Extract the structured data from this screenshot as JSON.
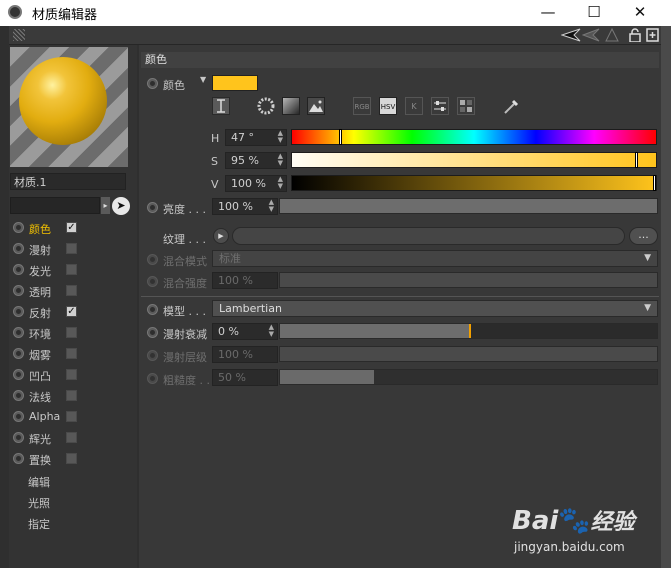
{
  "window": {
    "title": "材质编辑器",
    "minimize": "—",
    "maximize": "☐",
    "close": "✕"
  },
  "material": {
    "name": "材质.1",
    "name_field": ""
  },
  "channels": [
    {
      "label": "颜色",
      "checked": true,
      "active": true
    },
    {
      "label": "漫射",
      "checked": false,
      "active": false
    },
    {
      "label": "发光",
      "checked": false,
      "active": false
    },
    {
      "label": "透明",
      "checked": false,
      "active": false
    },
    {
      "label": "反射",
      "checked": true,
      "active": false
    },
    {
      "label": "环境",
      "checked": false,
      "active": false
    },
    {
      "label": "烟雾",
      "checked": false,
      "active": false
    },
    {
      "label": "凹凸",
      "checked": false,
      "active": false
    },
    {
      "label": "法线",
      "checked": false,
      "active": false
    },
    {
      "label": "Alpha",
      "checked": false,
      "active": false
    },
    {
      "label": "辉光",
      "checked": false,
      "active": false
    },
    {
      "label": "置换",
      "checked": false,
      "active": false
    }
  ],
  "nav": [
    {
      "label": "编辑",
      "active": true
    },
    {
      "label": "光照",
      "active": false
    },
    {
      "label": "指定",
      "active": false
    }
  ],
  "section": {
    "title": "颜色"
  },
  "color": {
    "label": "颜色",
    "swatch_color": "#ffc41c",
    "mode_buttons": [
      "RGB",
      "HSV",
      "K"
    ],
    "h": {
      "label": "H",
      "value": "47 °",
      "fraction": 0.13
    },
    "s": {
      "label": "S",
      "value": "95 %",
      "fraction": 0.95
    },
    "v": {
      "label": "V",
      "value": "100 %",
      "fraction": 1.0
    }
  },
  "brightness": {
    "label": "亮度 . . .",
    "value": "100 %",
    "fraction": 1.0
  },
  "texture": {
    "label": "纹理 . . .",
    "more": "..."
  },
  "blend_mode": {
    "label": "混合模式",
    "value": "标准"
  },
  "blend_strength": {
    "label": "混合强度",
    "value": "100 %",
    "fraction": 0.0
  },
  "model": {
    "label": "模型 . . .",
    "value": "Lambertian"
  },
  "diffuse_falloff": {
    "label": "漫射衰减",
    "value": "0 %",
    "fraction": 0.5
  },
  "diffuse_level": {
    "label": "漫射层级",
    "value": "100 %",
    "fraction": 0.0
  },
  "roughness": {
    "label": "粗糙度 . .",
    "value": "50 %",
    "fraction": 0.25
  },
  "watermark": {
    "brand": "Bai",
    "brand2": "经验",
    "url": "jingyan.baidu.com"
  }
}
